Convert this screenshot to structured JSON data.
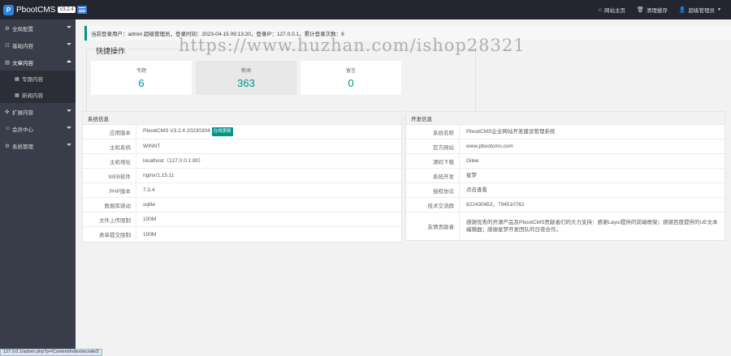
{
  "header": {
    "logo_letter": "P",
    "brand": "PbootCMS",
    "version": "V3.2.4",
    "links": [
      {
        "icon": "home-icon",
        "glyph": "⌂",
        "label": "网站主页"
      },
      {
        "icon": "trash-icon",
        "glyph": "🗑",
        "label": "清理缓存"
      },
      {
        "icon": "user-icon",
        "glyph": "👤",
        "label": "超级管理员"
      }
    ]
  },
  "sidebar": {
    "items": [
      {
        "icon": "gear-icon",
        "glyph": "⚙",
        "label": "全局配置"
      },
      {
        "icon": "sliders-icon",
        "glyph": "☷",
        "label": "基础内容"
      },
      {
        "icon": "file-icon",
        "glyph": "▤",
        "label": "文章内容"
      },
      {
        "icon": "puzzle-icon",
        "glyph": "✜",
        "label": "扩展内容"
      },
      {
        "icon": "user-icon",
        "glyph": "☺",
        "label": "会员中心"
      },
      {
        "icon": "cog-icon",
        "glyph": "⚙",
        "label": "系统管理"
      }
    ],
    "subitems": [
      {
        "icon": "doc-icon",
        "glyph": "▦",
        "label": "专题内容"
      },
      {
        "icon": "doc-icon",
        "glyph": "▦",
        "label": "新闻内容"
      }
    ]
  },
  "login_info": "当前登录用户：admin 超级管理员，登录时间：2023-04-15 09:13:20，登录IP：127.0.0.1，累计登录次数：6",
  "quick": {
    "legend": "快捷操作",
    "cards": [
      {
        "label": "专题",
        "value": "6"
      },
      {
        "label": "新闻",
        "value": "363"
      },
      {
        "label": "留言",
        "value": "0"
      }
    ]
  },
  "system": {
    "title": "系统信息",
    "rows": [
      {
        "k": "应用版本",
        "v": "PbootCMS V3.2.4 20230304",
        "tag": "在线更新"
      },
      {
        "k": "主机系统",
        "v": "WINNT"
      },
      {
        "k": "主机地址",
        "v": "localhost（127.0.0.1:80）"
      },
      {
        "k": "WEB软件",
        "v": "nginx/1.15.11"
      },
      {
        "k": "PHP版本",
        "v": "7.3.4"
      },
      {
        "k": "数据库驱动",
        "v": "sqlite"
      },
      {
        "k": "文件上传限制",
        "v": "100M"
      },
      {
        "k": "表单提交限制",
        "v": "100M"
      }
    ]
  },
  "dev": {
    "title": "开发信息",
    "rows": [
      {
        "k": "系统名称",
        "v": "PbootCMS企业网站开发建设管理系统"
      },
      {
        "k": "官方网站",
        "v": "www.pbootcms.com"
      },
      {
        "k": "源码下载",
        "v": "Gitee"
      },
      {
        "k": "系统开发",
        "v": "星梦"
      },
      {
        "k": "授权协议",
        "v": "点击查看"
      },
      {
        "k": "技术交流群",
        "v": "822430453，794510762"
      },
      {
        "k": "友情贡献者",
        "v": "感谢优秀的开源产品及PbootCMS贡献者们的大力支持：感谢Layui提供的前端框架；感谢百度提供的UE文本编辑器；感谢星梦开发团队的日夜合作。"
      }
    ]
  },
  "watermark": "https://www.huzhan.com/ishop28321",
  "statusbar": "127.0.0.1/admin.php?p=/Content/index/mcode/2"
}
